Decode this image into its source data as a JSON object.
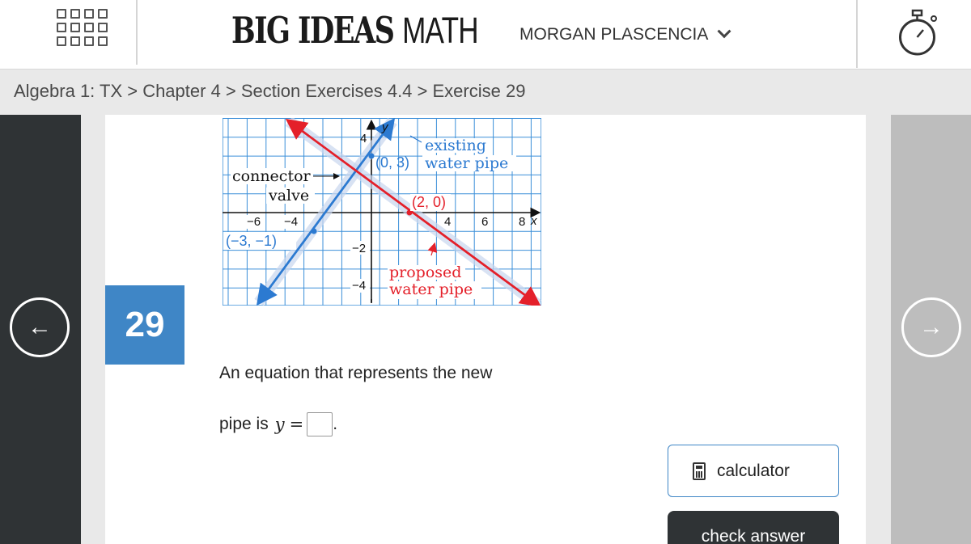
{
  "header": {
    "brand_main": "BIG IDEAS ",
    "brand_math": "MATH",
    "user_name": "MORGAN PLASCENCIA"
  },
  "breadcrumb": "Algebra 1: TX > Chapter 4 > Section Exercises 4.4 > Exercise 29",
  "exercise": {
    "number": "29",
    "question_line1": "An equation that represents the new",
    "question_line2": "pipe is",
    "variable": "y",
    "equals": "=",
    "period": "."
  },
  "graph": {
    "labels": {
      "existing": "existing",
      "water_pipe_existing": "water pipe",
      "point_0_3": "(0, 3)",
      "connector": "connector",
      "valve": "valve",
      "point_2_0": "(2, 0)",
      "point_neg3_neg1": "(−3, −1)",
      "proposed": "proposed",
      "water_pipe_proposed": "water pipe",
      "y_axis": "y",
      "x_axis": "x",
      "tick_x_neg6": "−6",
      "tick_x_neg4": "−4",
      "tick_x_4": "4",
      "tick_x_6": "6",
      "tick_x_8": "8",
      "tick_y_4": "4",
      "tick_y_neg2": "−2",
      "tick_y_neg4": "−4"
    },
    "colors": {
      "existing": "#2c7ad1",
      "proposed": "#e4202a",
      "grid": "#3b8fd9"
    }
  },
  "buttons": {
    "calculator": "calculator",
    "check_answer": "check answer"
  },
  "icons": {
    "menu": "grid-menu-icon",
    "timer": "stopwatch-icon",
    "prev": "arrow-left-icon",
    "next": "arrow-right-icon",
    "calculator": "calculator-icon"
  }
}
